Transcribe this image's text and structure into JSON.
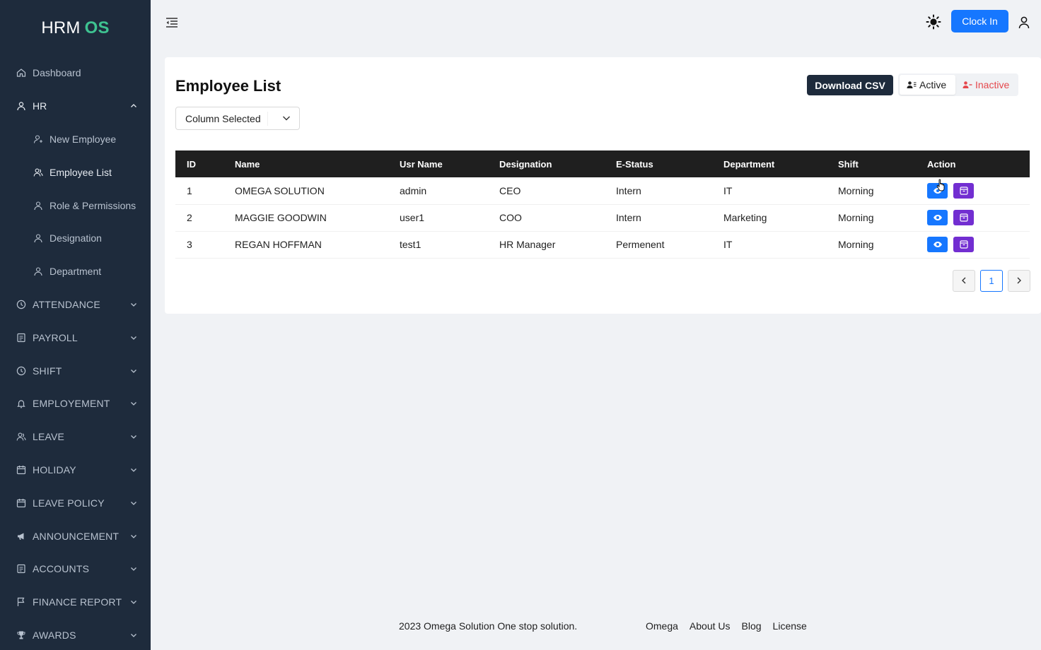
{
  "brand": {
    "part1": "HRM",
    "part2": "OS"
  },
  "sidebar": {
    "items": [
      {
        "label": "Dashboard",
        "icon": "home-icon"
      },
      {
        "label": "HR",
        "icon": "user-icon",
        "open": true
      },
      {
        "label": "ATTENDANCE",
        "icon": "clock-icon"
      },
      {
        "label": "PAYROLL",
        "icon": "file-icon"
      },
      {
        "label": "SHIFT",
        "icon": "clock-icon"
      },
      {
        "label": "EMPLOYEMENT",
        "icon": "bell-icon"
      },
      {
        "label": "LEAVE",
        "icon": "users-icon"
      },
      {
        "label": "HOLIDAY",
        "icon": "calendar-icon"
      },
      {
        "label": "LEAVE POLICY",
        "icon": "calendar-icon"
      },
      {
        "label": "ANNOUNCEMENT",
        "icon": "megaphone-icon"
      },
      {
        "label": "ACCOUNTS",
        "icon": "ledger-icon"
      },
      {
        "label": "FINANCE REPORT",
        "icon": "flag-icon"
      },
      {
        "label": "AWARDS",
        "icon": "trophy-icon"
      }
    ],
    "hr_sub": [
      {
        "label": "New Employee",
        "icon": "user-add-icon"
      },
      {
        "label": "Employee List",
        "icon": "users-icon",
        "active": true
      },
      {
        "label": "Role & Permissions",
        "icon": "user-icon"
      },
      {
        "label": "Designation",
        "icon": "user-icon"
      },
      {
        "label": "Department",
        "icon": "user-icon"
      }
    ]
  },
  "header": {
    "clock_in": "Clock In"
  },
  "page": {
    "title": "Employee List",
    "download_csv": "Download CSV",
    "filter_active": "Active",
    "filter_inactive": "Inactive",
    "column_select": "Column Selected"
  },
  "table": {
    "columns": [
      "ID",
      "Name",
      "Usr Name",
      "Designation",
      "E-Status",
      "Department",
      "Shift",
      "Action"
    ],
    "rows": [
      [
        "1",
        "OMEGA SOLUTION",
        "admin",
        "CEO",
        "Intern",
        "IT",
        "Morning"
      ],
      [
        "2",
        "MAGGIE GOODWIN",
        "user1",
        "COO",
        "Intern",
        "Marketing",
        "Morning"
      ],
      [
        "3",
        "REGAN HOFFMAN",
        "test1",
        "HR Manager",
        "Permenent",
        "IT",
        "Morning"
      ]
    ]
  },
  "pagination": {
    "current": "1"
  },
  "footer": {
    "copyright": "2023 Omega Solution One stop solution.",
    "links": [
      "Omega",
      "About Us",
      "Blog",
      "License"
    ]
  },
  "colors": {
    "sidebar_bg": "#1e2b3c",
    "brand_accent": "#3ec291",
    "primary": "#1677ff",
    "edit": "#722ed1",
    "inactive": "#e5484d"
  }
}
